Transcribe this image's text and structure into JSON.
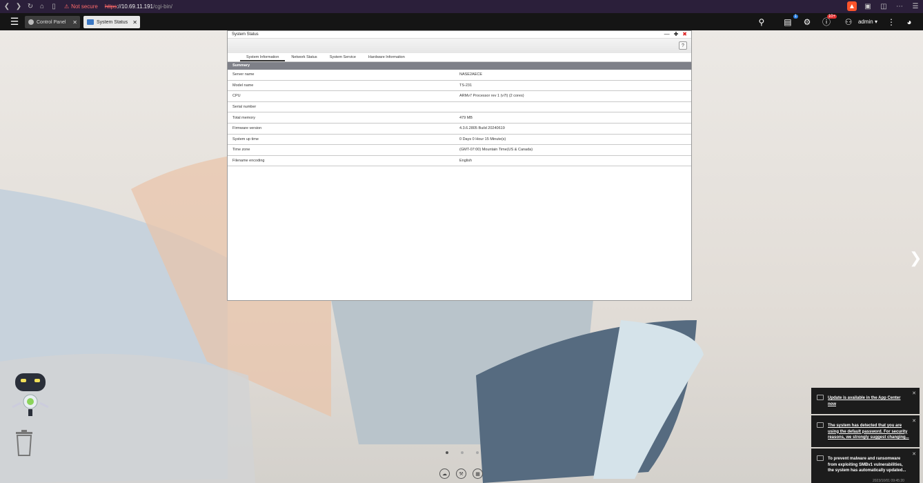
{
  "browser": {
    "security_label": "Not secure",
    "url_scheme": "https",
    "url_host": "://10.69.11.191",
    "url_path": "/cgi-bin/"
  },
  "qts": {
    "tabs": [
      {
        "label": "Control Panel"
      },
      {
        "label": "System Status"
      }
    ],
    "tasks_badge": "1",
    "notifications_badge": "10+",
    "user": "admin"
  },
  "window": {
    "title": "System Status",
    "help": "?",
    "tabs": [
      "System Information",
      "Network Status",
      "System Service",
      "Hardware Information"
    ],
    "active_tab": 0,
    "section": "Summary",
    "rows": [
      {
        "key": "Server name",
        "value": "NASE2AECE"
      },
      {
        "key": "Model name",
        "value": "TS-231"
      },
      {
        "key": "CPU",
        "value": "ARMv7 Processor rev 1 (v7l) (2 cores)"
      },
      {
        "key": "Serial number",
        "value": ""
      },
      {
        "key": "Total memory",
        "value": "479 MB"
      },
      {
        "key": "Firmware version",
        "value": "4.3.6.2805 Build 20240619"
      },
      {
        "key": "System up time",
        "value": "0 Days 0 Hour 15 Minute(s)"
      },
      {
        "key": "Time zone",
        "value": "(GMT-07:00) Mountain Time(US & Canada)"
      },
      {
        "key": "Filename encoding",
        "value": "English"
      }
    ]
  },
  "notifications": [
    {
      "text": "Update is available in the App Center now"
    },
    {
      "text": "The system has detected that you are using the default password. For security reasons, we strongly suggest changing..."
    },
    {
      "text": "To prevent malware and ransomware from exploiting SMBv1 vulnerabilities, the system has automatically updated..."
    }
  ],
  "timestamp": "2023/10/01 09:45:20",
  "colors": {
    "browser_bar": "#2b1f3a",
    "qts_bar": "#151515",
    "section_header": "#7e8088",
    "notification_bg": "#1c1c1c"
  }
}
